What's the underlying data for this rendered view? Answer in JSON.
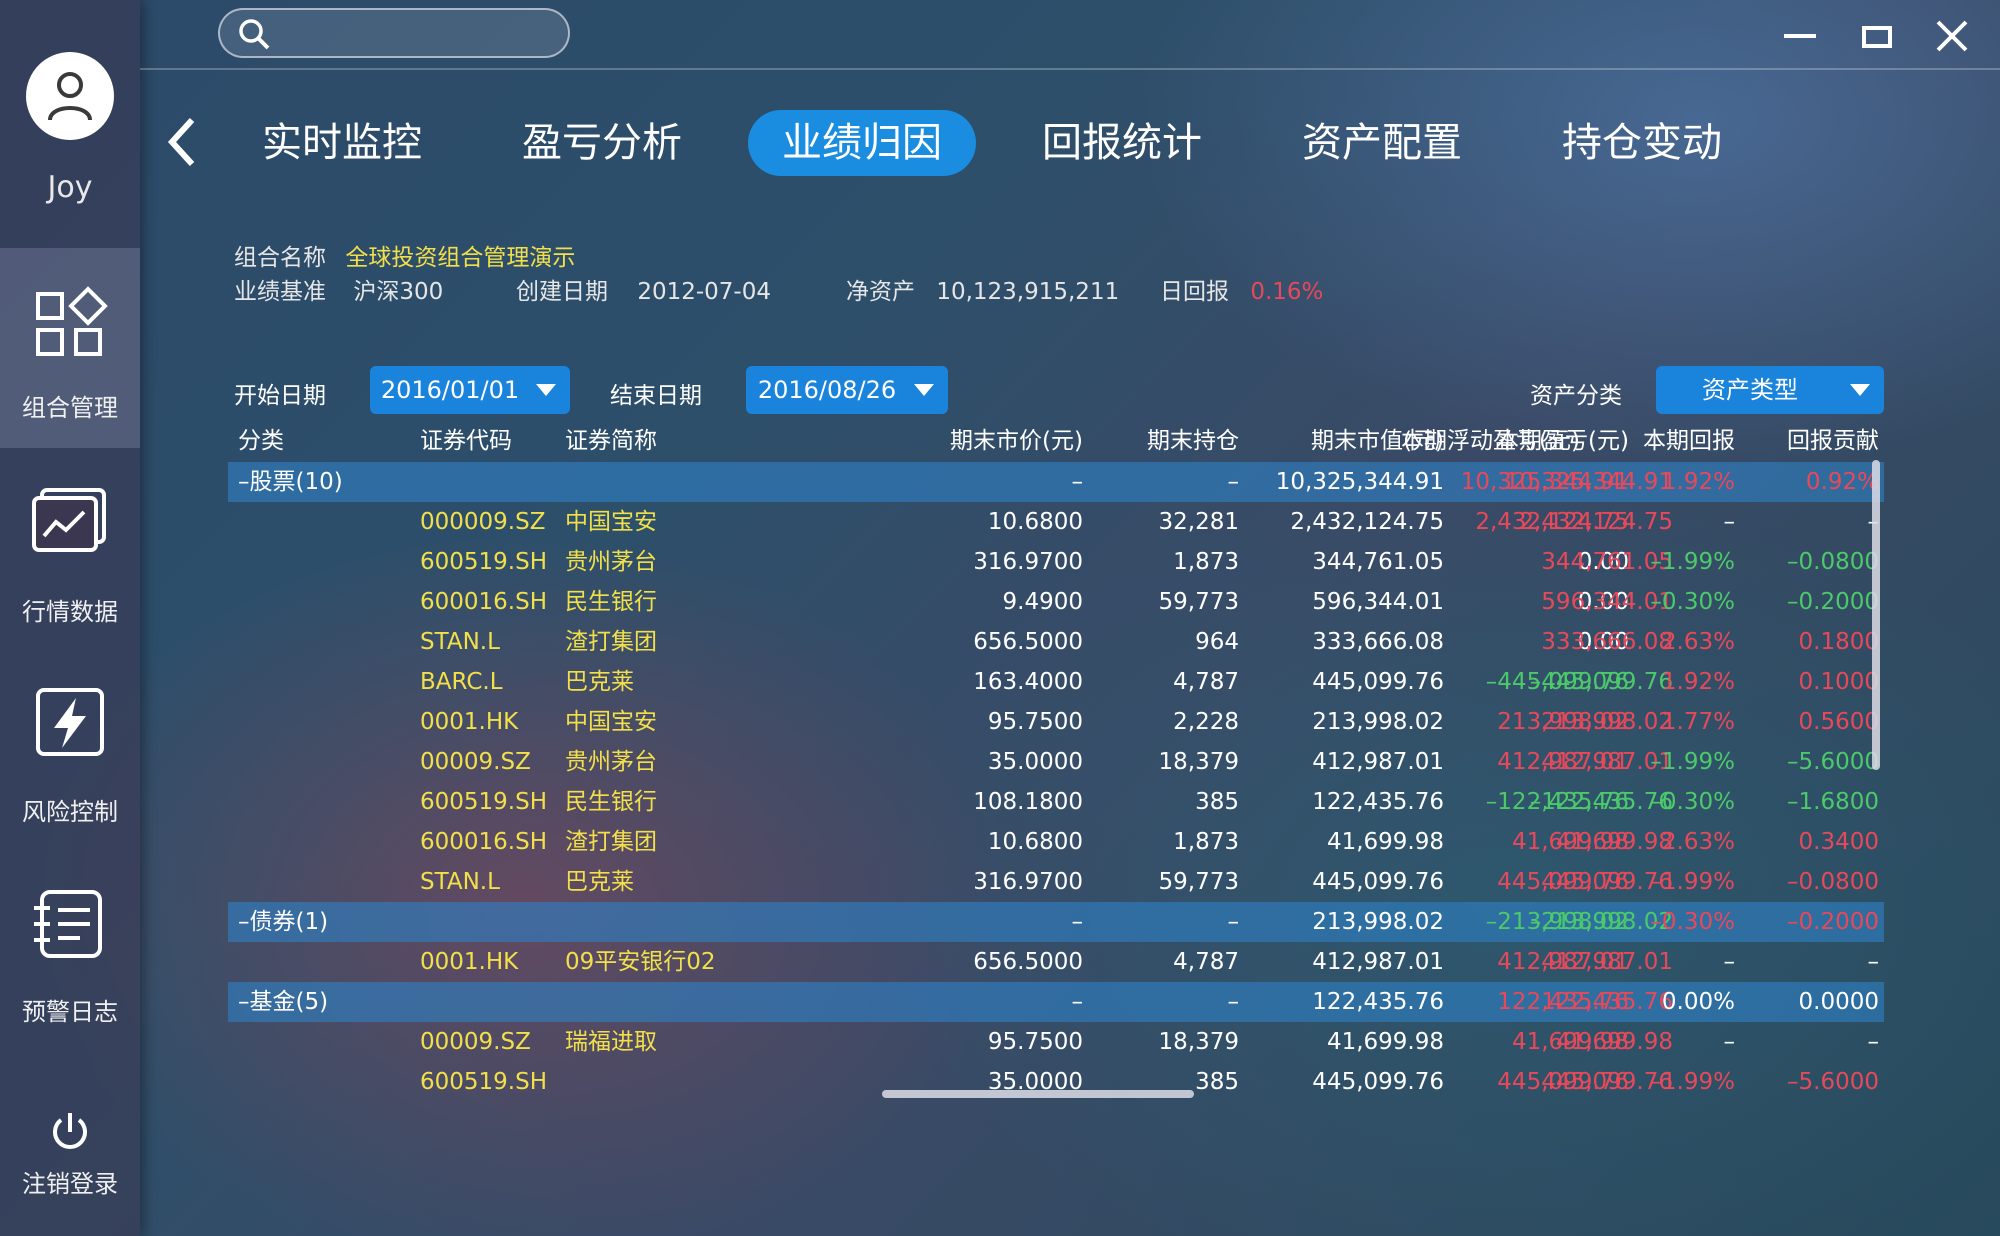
{
  "user": {
    "name": "Joy"
  },
  "sidebar": {
    "items": [
      {
        "label": "组合管理",
        "icon": "portfolio-grid-icon",
        "active": true
      },
      {
        "label": "行情数据",
        "icon": "market-chart-icon",
        "active": false
      },
      {
        "label": "风险控制",
        "icon": "risk-bolt-icon",
        "active": false
      },
      {
        "label": "预警日志",
        "icon": "alert-log-icon",
        "active": false
      }
    ],
    "logout_label": "注销登录"
  },
  "search": {
    "placeholder": ""
  },
  "tabs": [
    {
      "label": "实时监控",
      "active": false
    },
    {
      "label": "盈亏分析",
      "active": false
    },
    {
      "label": "业绩归因",
      "active": true
    },
    {
      "label": "回报统计",
      "active": false
    },
    {
      "label": "资产配置",
      "active": false
    },
    {
      "label": "持仓变动",
      "active": false
    }
  ],
  "portfolio": {
    "name_label": "组合名称",
    "name_value": "全球投资组合管理演示",
    "benchmark_label": "业绩基准",
    "benchmark_value": "沪深300",
    "created_label": "创建日期",
    "created_value": "2012-07-04",
    "nav_label": "净资产",
    "nav_value": "10,123,915,211",
    "daily_label": "日回报",
    "daily_value": "0.16%"
  },
  "filters": {
    "start_label": "开始日期",
    "start_value": "2016/01/01",
    "end_label": "结束日期",
    "end_value": "2016/08/26",
    "asset_label": "资产分类",
    "asset_value": "资产类型"
  },
  "colors": {
    "accent": "#1a8de0",
    "code": "#f2e04a",
    "up": "#e8495a",
    "down": "#4cc96a"
  },
  "table": {
    "headers": [
      "分类",
      "证券代码",
      "证券简称",
      "期末市价(元)",
      "期末持仓",
      "期末市值(元)",
      "本期盈亏(元)",
      "本期浮动盈亏(元)",
      "本期回报",
      "回报贡献"
    ],
    "rows": [
      {
        "type": "group",
        "cells": [
          "–股票(10)",
          "",
          "",
          "–",
          "–",
          "10,325,344.91",
          "10,325,344.91",
          "10,325,344.91",
          "1.92%",
          "0.92%"
        ],
        "tone": [
          "",
          "",
          "",
          "",
          "",
          "",
          "red",
          "red",
          "red",
          "red"
        ]
      },
      {
        "type": "item",
        "cells": [
          "",
          "000009.SZ",
          "中国宝安",
          "10.6800",
          "32,281",
          "2,432,124.75",
          "2,432,124.75",
          "2,432,124.75",
          "–",
          "–"
        ],
        "tone": [
          "",
          "",
          "",
          "",
          "",
          "",
          "red",
          "red",
          "",
          ""
        ]
      },
      {
        "type": "item",
        "cells": [
          "",
          "600519.SH",
          "贵州茅台",
          "316.9700",
          "1,873",
          "344,761.05",
          "0.00",
          "344,761.05",
          "–1.99%",
          "–0.0800"
        ],
        "tone": [
          "",
          "",
          "",
          "",
          "",
          "",
          "",
          "red",
          "green",
          "green"
        ]
      },
      {
        "type": "item",
        "cells": [
          "",
          "600016.SH",
          "民生银行",
          "9.4900",
          "59,773",
          "596,344.01",
          "0.00",
          "596,344.01",
          "–0.30%",
          "–0.2000"
        ],
        "tone": [
          "",
          "",
          "",
          "",
          "",
          "",
          "",
          "red",
          "green",
          "green"
        ]
      },
      {
        "type": "item",
        "cells": [
          "",
          "STAN.L",
          "渣打集团",
          "656.5000",
          "964",
          "333,666.08",
          "0.00",
          "333,666.08",
          "2.63%",
          "0.1800"
        ],
        "tone": [
          "",
          "",
          "",
          "",
          "",
          "",
          "",
          "red",
          "red",
          "red"
        ]
      },
      {
        "type": "item",
        "cells": [
          "",
          "BARC.L",
          "巴克莱",
          "163.4000",
          "4,787",
          "445,099.76",
          "–445,099.76",
          "–445,099.76",
          "1.92%",
          "0.1000"
        ],
        "tone": [
          "",
          "",
          "",
          "",
          "",
          "",
          "green",
          "green",
          "red",
          "red"
        ]
      },
      {
        "type": "item",
        "cells": [
          "",
          "0001.HK",
          "中国宝安",
          "95.7500",
          "2,228",
          "213,998.02",
          "213,998.02",
          "213,998.02",
          "1.77%",
          "0.5600"
        ],
        "tone": [
          "",
          "",
          "",
          "",
          "",
          "",
          "red",
          "red",
          "red",
          "red"
        ]
      },
      {
        "type": "item",
        "cells": [
          "",
          "00009.SZ",
          "贵州茅台",
          "35.0000",
          "18,379",
          "412,987.01",
          "412,987.01",
          "412,987.01",
          "–1.99%",
          "–5.6000"
        ],
        "tone": [
          "",
          "",
          "",
          "",
          "",
          "",
          "red",
          "red",
          "green",
          "green"
        ]
      },
      {
        "type": "item",
        "cells": [
          "",
          "600519.SH",
          "民生银行",
          "108.1800",
          "385",
          "122,435.76",
          "–122,435.76",
          "–122,435.76",
          "–0.30%",
          "–1.6800"
        ],
        "tone": [
          "",
          "",
          "",
          "",
          "",
          "",
          "green",
          "green",
          "green",
          "green"
        ]
      },
      {
        "type": "item",
        "cells": [
          "",
          "600016.SH",
          "渣打集团",
          "10.6800",
          "1,873",
          "41,699.98",
          "41,699.98",
          "41,699.98",
          "2.63%",
          "0.3400"
        ],
        "tone": [
          "",
          "",
          "",
          "",
          "",
          "",
          "red",
          "red",
          "red",
          "red"
        ]
      },
      {
        "type": "item",
        "cells": [
          "",
          "STAN.L",
          "巴克莱",
          "316.9700",
          "59,773",
          "445,099.76",
          "445,099.76",
          "445,099.76",
          "–1.99%",
          "–0.0800"
        ],
        "tone": [
          "",
          "",
          "",
          "",
          "",
          "",
          "red",
          "red",
          "red",
          "red"
        ]
      },
      {
        "type": "group",
        "cells": [
          "–债券(1)",
          "",
          "",
          "–",
          "–",
          "213,998.02",
          "–213,998.02",
          "–213,998.02",
          "–0.30%",
          "–0.2000"
        ],
        "tone": [
          "",
          "",
          "",
          "",
          "",
          "",
          "green",
          "green",
          "red",
          "red"
        ]
      },
      {
        "type": "item",
        "cells": [
          "",
          "0001.HK",
          "09平安银行02",
          "656.5000",
          "4,787",
          "412,987.01",
          "412,987.01",
          "412,987.01",
          "–",
          "–"
        ],
        "tone": [
          "",
          "",
          "",
          "",
          "",
          "",
          "red",
          "red",
          "",
          ""
        ]
      },
      {
        "type": "group",
        "cells": [
          "–基金(5)",
          "",
          "",
          "–",
          "–",
          "122,435.76",
          "122,435.76",
          "122,435.76",
          "0.00%",
          "0.0000"
        ],
        "tone": [
          "",
          "",
          "",
          "",
          "",
          "",
          "red",
          "red",
          "",
          ""
        ]
      },
      {
        "type": "item",
        "cells": [
          "",
          "00009.SZ",
          "瑞福进取",
          "95.7500",
          "18,379",
          "41,699.98",
          "41,699.98",
          "41,699.98",
          "–",
          "–"
        ],
        "tone": [
          "",
          "",
          "",
          "",
          "",
          "",
          "red",
          "red",
          "",
          ""
        ]
      },
      {
        "type": "item",
        "cells": [
          "",
          "600519.SH",
          "",
          "35.0000",
          "385",
          "445,099.76",
          "445,099.76",
          "445,099.76",
          "–1.99%",
          "–5.6000"
        ],
        "tone": [
          "",
          "",
          "",
          "",
          "",
          "",
          "red",
          "red",
          "red",
          "red"
        ]
      }
    ]
  }
}
